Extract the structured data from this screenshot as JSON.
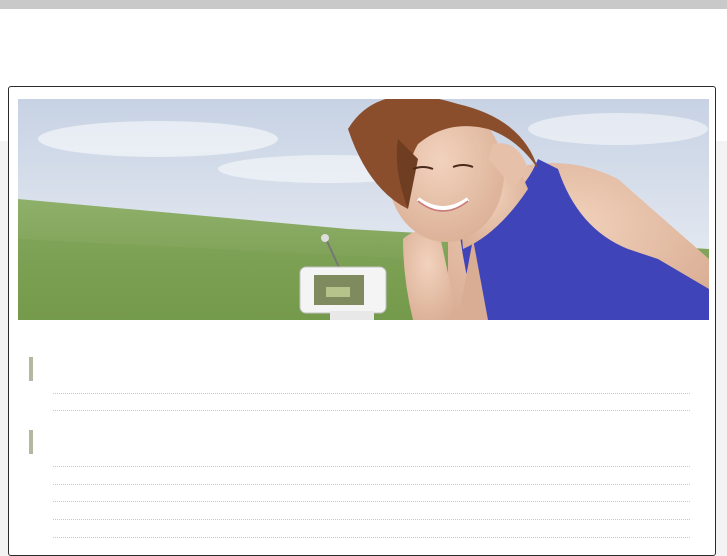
{
  "page": {
    "colors": {
      "top_bar": "#c9c9c9",
      "page_background": "#f3f3f3",
      "card_border": "#2b2b2b",
      "section_marker": "#b3b8a3",
      "divider": "#c8c8c8"
    }
  },
  "hero": {
    "image_subject": "woman-lying-on-grass-with-handheld-console"
  },
  "sections": [
    {
      "marker_icon": "section-bar-icon",
      "rows": 2
    },
    {
      "marker_icon": "section-bar-icon",
      "rows": 5
    }
  ]
}
